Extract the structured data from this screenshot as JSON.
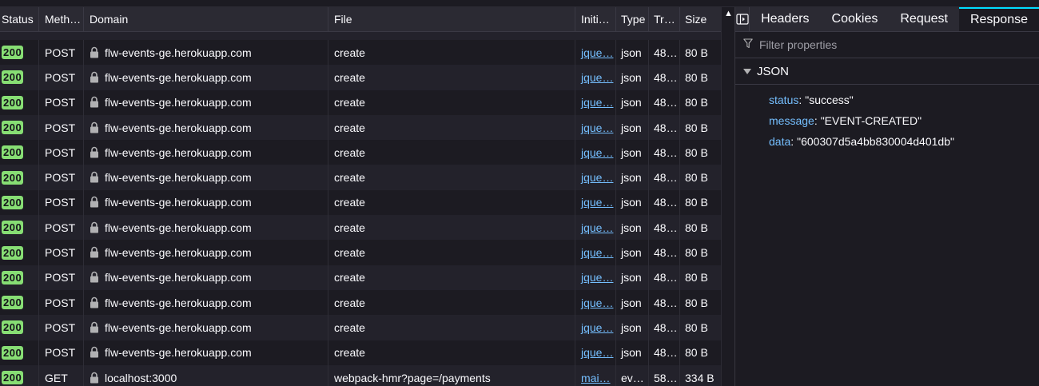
{
  "table": {
    "columns": {
      "status": "Status",
      "method": "Meth…",
      "domain": "Domain",
      "file": "File",
      "initiator": "Initi…",
      "type": "Type",
      "transferred": "Tr…",
      "size": "Size"
    },
    "rows": [
      {
        "status": "200",
        "method": "POST",
        "domain": "flw-events-ge.herokuapp.com",
        "file": "create",
        "initiator": "jque…",
        "type": "json",
        "transferred": "48…",
        "size": "80 B"
      },
      {
        "status": "200",
        "method": "POST",
        "domain": "flw-events-ge.herokuapp.com",
        "file": "create",
        "initiator": "jque…",
        "type": "json",
        "transferred": "48…",
        "size": "80 B"
      },
      {
        "status": "200",
        "method": "POST",
        "domain": "flw-events-ge.herokuapp.com",
        "file": "create",
        "initiator": "jque…",
        "type": "json",
        "transferred": "48…",
        "size": "80 B"
      },
      {
        "status": "200",
        "method": "POST",
        "domain": "flw-events-ge.herokuapp.com",
        "file": "create",
        "initiator": "jque…",
        "type": "json",
        "transferred": "48…",
        "size": "80 B"
      },
      {
        "status": "200",
        "method": "POST",
        "domain": "flw-events-ge.herokuapp.com",
        "file": "create",
        "initiator": "jque…",
        "type": "json",
        "transferred": "48…",
        "size": "80 B"
      },
      {
        "status": "200",
        "method": "POST",
        "domain": "flw-events-ge.herokuapp.com",
        "file": "create",
        "initiator": "jque…",
        "type": "json",
        "transferred": "48…",
        "size": "80 B"
      },
      {
        "status": "200",
        "method": "POST",
        "domain": "flw-events-ge.herokuapp.com",
        "file": "create",
        "initiator": "jque…",
        "type": "json",
        "transferred": "48…",
        "size": "80 B"
      },
      {
        "status": "200",
        "method": "POST",
        "domain": "flw-events-ge.herokuapp.com",
        "file": "create",
        "initiator": "jque…",
        "type": "json",
        "transferred": "48…",
        "size": "80 B"
      },
      {
        "status": "200",
        "method": "POST",
        "domain": "flw-events-ge.herokuapp.com",
        "file": "create",
        "initiator": "jque…",
        "type": "json",
        "transferred": "48…",
        "size": "80 B"
      },
      {
        "status": "200",
        "method": "POST",
        "domain": "flw-events-ge.herokuapp.com",
        "file": "create",
        "initiator": "jque…",
        "type": "json",
        "transferred": "48…",
        "size": "80 B"
      },
      {
        "status": "200",
        "method": "POST",
        "domain": "flw-events-ge.herokuapp.com",
        "file": "create",
        "initiator": "jque…",
        "type": "json",
        "transferred": "48…",
        "size": "80 B"
      },
      {
        "status": "200",
        "method": "POST",
        "domain": "flw-events-ge.herokuapp.com",
        "file": "create",
        "initiator": "jque…",
        "type": "json",
        "transferred": "48…",
        "size": "80 B"
      },
      {
        "status": "200",
        "method": "POST",
        "domain": "flw-events-ge.herokuapp.com",
        "file": "create",
        "initiator": "jque…",
        "type": "json",
        "transferred": "48…",
        "size": "80 B"
      },
      {
        "status": "200",
        "method": "GET",
        "domain": "localhost:3000",
        "file": "webpack-hmr?page=/payments",
        "initiator": "mai…",
        "type": "ev…",
        "transferred": "58…",
        "size": "334 B"
      }
    ],
    "icons": {
      "secure": "lock-icon",
      "scroll_up": "scroll-up-arrow-icon"
    }
  },
  "details": {
    "toggle_icon": "sidebar-toggle-icon",
    "tabs": [
      "Headers",
      "Cookies",
      "Request",
      "Response"
    ],
    "active_tab": "Response",
    "filter": {
      "placeholder": "Filter properties",
      "value": "",
      "icon": "filter-icon"
    },
    "json_section": "JSON",
    "json": [
      {
        "key": "status",
        "value": "\"success\""
      },
      {
        "key": "message",
        "value": "\"EVENT-CREATED\""
      },
      {
        "key": "data",
        "value": "\"600307d5a4bb830004d401db\""
      }
    ]
  },
  "colors": {
    "background": "#1c1b22",
    "row_alt": "#23222b",
    "header": "#2b2a33",
    "status_ok": "#87de74",
    "link": "#75bfff",
    "active_tab_accent": "#00ddff"
  }
}
